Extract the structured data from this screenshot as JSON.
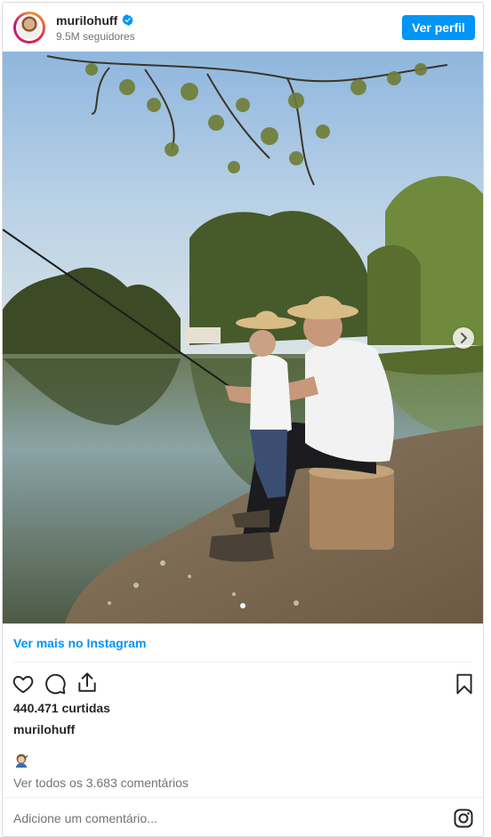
{
  "header": {
    "username": "murilohuff",
    "followers": "9.5M seguidores",
    "profile_button": "Ver perfil"
  },
  "post": {
    "more_link": "Ver mais no Instagram",
    "likes": "440.471 curtidas",
    "caption_user": "murilohuff",
    "view_comments": "Ver todos os 3.683 comentários",
    "comment_placeholder": "Adicione um comentário...",
    "carousel_index": 1,
    "carousel_total": 1
  },
  "icons": {
    "verified": "verified-badge-icon",
    "like": "heart-icon",
    "comment": "comment-icon",
    "share": "share-icon",
    "save": "bookmark-icon",
    "next": "chevron-right-icon",
    "instagram": "instagram-icon",
    "emoji": "person-emoji-icon"
  },
  "colors": {
    "accent": "#0095f6",
    "text": "#262626",
    "muted": "#737373",
    "border": "#dbdbdb"
  }
}
